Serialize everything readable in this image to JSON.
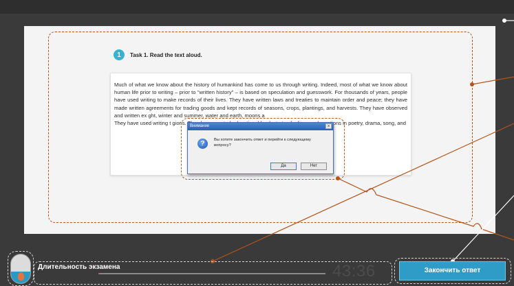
{
  "task": {
    "number": "1",
    "title": "Task 1. Read the text aloud."
  },
  "reading": {
    "paragraph1": "Much of what we know about the history of humankind has come to us through writing. Indeed, most of what we know about human life prior to writing – prior to \"written history\" – is based on speculation and guesswork. For thousands of years, people have used writing to make records of their lives. They have written laws and treaties to maintain order and peace; they have made written agreements for trading goods and kept records of seasons, crops, plantings, and harvests. They have observed and written ex                                              ght, winter and summer, water and earth, moons a",
    "paragraph2": "They have used writing t                                                   gions. They have created educational books to tea                                              feelings and emotions in poetry, drama, song, and"
  },
  "dialog": {
    "title": "Внимание",
    "close": "×",
    "icon": "question-icon",
    "message": "Вы хотите закончить ответ и перейти к следующему вопросу?",
    "yes_label": "Да",
    "no_label": "Нет"
  },
  "footer": {
    "duration_label": "Длительность экзамена",
    "timer": "43:36",
    "progress_fraction": 0.0,
    "finish_label": "Закончить ответ",
    "mic_level_fraction": 0.4
  },
  "colors": {
    "accent": "#3ab2cf",
    "callout": "#b4541a",
    "progress": "#d9534f",
    "background": "#3a3a3a"
  }
}
